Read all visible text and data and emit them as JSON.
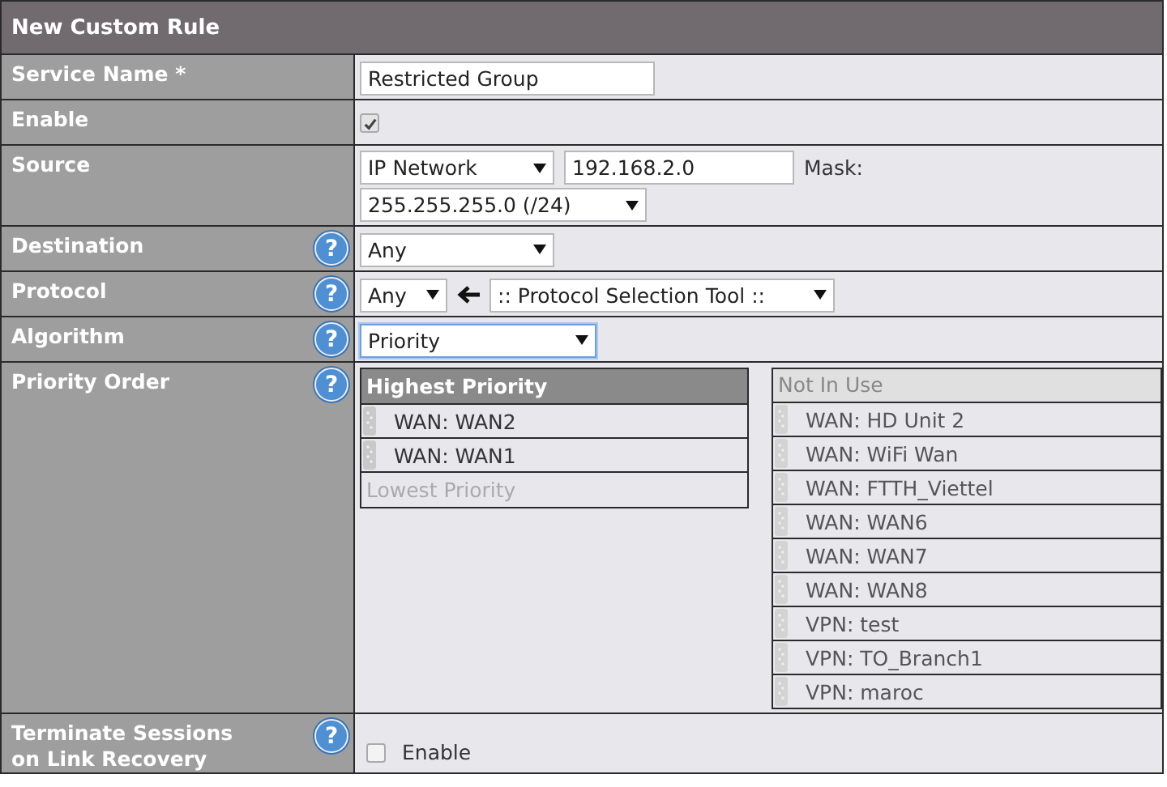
{
  "title": "New Custom Rule",
  "rows": [
    {
      "label": "Service Name *",
      "kind": "text",
      "value": "Restricted Group"
    },
    {
      "label": "Enable",
      "kind": "checkbox",
      "checked": true
    },
    {
      "label": "Source",
      "kind": "source",
      "type": "IP Network",
      "address": "192.168.2.0",
      "mask_label": "Mask:",
      "mask": "255.255.255.0 (/24)"
    },
    {
      "label": "Destination",
      "help": "?",
      "kind": "select",
      "value": "Any",
      "focused": false
    },
    {
      "label": "Protocol",
      "help": "?",
      "kind": "protocol",
      "value": "Any",
      "tool": ":: Protocol Selection Tool ::"
    },
    {
      "label": "Algorithm",
      "help": "?",
      "kind": "select",
      "value": "Priority",
      "focused": true
    },
    {
      "label": "Priority Order",
      "help": "?",
      "kind": "priority",
      "in_use": {
        "header": "Highest Priority",
        "items": [
          "WAN: WAN2",
          "WAN: WAN1"
        ],
        "footer": "Lowest Priority"
      },
      "not_in_use": {
        "header": "Not In Use",
        "items": [
          "WAN: HD Unit 2",
          "WAN: WiFi Wan",
          "WAN: FTTH_Viettel",
          "WAN: WAN6",
          "WAN: WAN7",
          "WAN: WAN8",
          "VPN: test",
          "VPN: TO_Branch1",
          "VPN: maroc"
        ]
      }
    },
    {
      "label": "Terminate Sessions\non Link Recovery",
      "help": "?",
      "kind": "option",
      "text": "Enable",
      "checked": false
    }
  ]
}
